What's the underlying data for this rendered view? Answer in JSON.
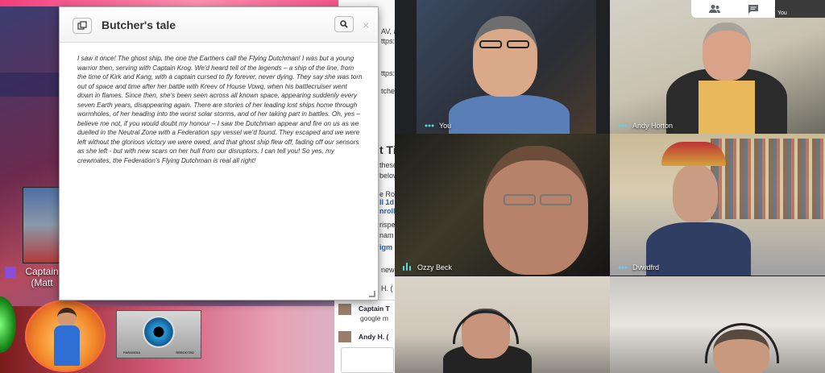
{
  "handout": {
    "title": "Butcher's tale",
    "body": "I saw it once! The ghost ship, the one the Earthers call the Flying Dutchman! I was but a young warrior then, serving with Captain Krog. We'd heard tell of the legends – a ship of the line, from the time of Kirk and Kang, with a captain cursed to fly forever, never dying. They say she was torn out of space and time after her battle with Kreev of House Vowq, when his battlecruiser went down in flames. Since then, she's been seen across all known space, appearing suddenly every seven Earth years, disappearing again. There are stories of her leading lost ships home through wormholes, of her heading into the worst solar storms, and of her taking part in battles. Oh, yes – believe me not, if you would doubt my honour – I saw the Dutchman appear and fire on us as we duelled in the Neutral Zone with a Federation spy vessel we'd found. They escaped and we were left without the glorious victory we were owed, and that ghost ship flew off, fading off our sensors as she left - but with new scars on her hull from our disruptors, I can tell you! So yes, my crewmates, the Federation's Flying Dutchman is real all right!",
    "close_glyph": "×"
  },
  "vtt": {
    "token_label_line1": "Captain",
    "token_label_line2": "(Matt",
    "card_left": "PARANOIA",
    "card_right": "REBOOTED"
  },
  "chat_fragments": [
    "AV, and th",
    "ttps://",
    "ttps://m",
    "tcher's",
    "t Ti",
    "these",
    "below",
    "e Ro",
    "ll 1d",
    "nroll",
    "rispe",
    "nam",
    "igm",
    "new",
    "H. ("
  ],
  "chat_messages": [
    {
      "name": "Captain T",
      "text": "google m"
    },
    {
      "name": "Andy H. (",
      "text": ""
    }
  ],
  "video": {
    "participants": [
      {
        "name": "You",
        "indicator": "dots"
      },
      {
        "name": "Andy Horton",
        "indicator": "dots"
      },
      {
        "name": "Ozzy Beck",
        "indicator": "bars"
      },
      {
        "name": "Dvwdfrd",
        "indicator": "dots"
      },
      {
        "name": "",
        "indicator": "none"
      },
      {
        "name": "",
        "indicator": "none"
      }
    ],
    "self_thumb_label": "You",
    "accent_color": "#5fd4e4"
  }
}
